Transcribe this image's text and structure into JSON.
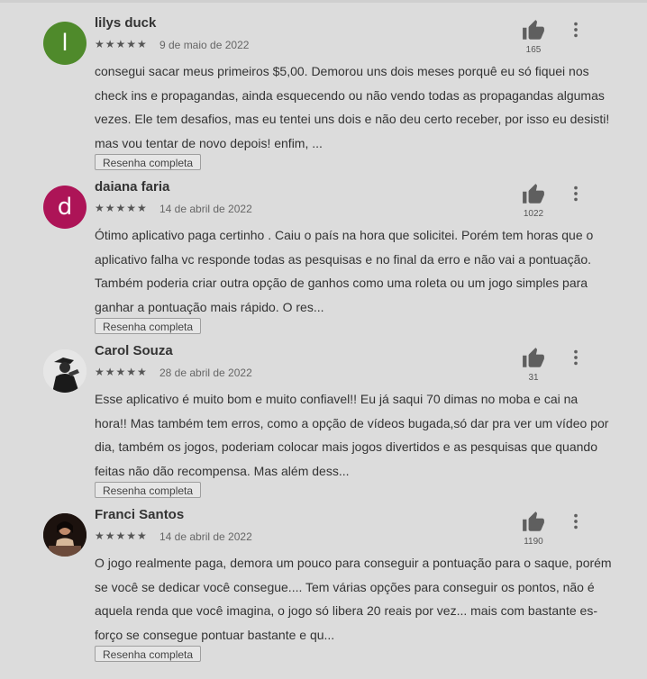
{
  "reviews": [
    {
      "author": "lilys duck",
      "avatar_letter": "l",
      "avatar_color": "#4f8a2b",
      "stars": "★★★★★",
      "date": "9 de maio de 2022",
      "likes": "165",
      "text": "consegui sacar meus primeiros $5,00. Demorou uns dois meses porquê eu só fiquei nos check ins e propagandas, ainda esquecendo ou não vendo todas as propagandas algumas vezes. Ele tem desafios, mas eu tentei uns dois e não deu certo receber, por isso eu desisti! mas vou tentar de novo depois! enfim, ...",
      "full_label": "Resenha completa"
    },
    {
      "author": "daiana faria",
      "avatar_letter": "d",
      "avatar_color": "#ad1457",
      "stars": "★★★★★",
      "date": "14 de abril de 2022",
      "likes": "1022",
      "text": "Ótimo aplicativo paga certinho . Caiu o país na hora que solicitei. Porém tem horas que o aplicativo falha vc responde todas as pesquisas e no final da erro e não vai a pontuação. Também poderia criar outra opção de ganhos como uma roleta ou um jogo simples para ganhar a pontuação mais rápido. O res...",
      "full_label": "Resenha completa"
    },
    {
      "author": "Carol Souza",
      "avatar_letter": "",
      "avatar_color": "#e9e9e9",
      "stars": "★★★★★",
      "date": "28 de abril de 2022",
      "likes": "31",
      "text": "Esse aplicativo é muito bom e muito confiavel!! Eu já saqui 70 dimas no moba e cai na hora!! Mas também tem erros, como a opção de vídeos bugada,só dar pra ver um vídeo por dia, também os jogos, poderiam colocar mais jogos divertidos e as pesquisas que quando feitas não dão recompensa. Mas além dess...",
      "full_label": "Resenha completa"
    },
    {
      "author": "Franci Santos",
      "avatar_letter": "",
      "avatar_color": "#2a1a14",
      "stars": "★★★★★",
      "date": "14 de abril de 2022",
      "likes": "1190",
      "text": "O jogo realmente paga, demora um pouco para conseguir a pontuação para o saque, porém se você se dedicar você consegue.... Tem várias opções para conseguir os pontos, não é aquela renda que você imagina, o jogo só libera 20 reais por vez... mais com bastante es-forço se consegue pontuar bastante e qu...",
      "full_label": "Resenha completa"
    }
  ]
}
